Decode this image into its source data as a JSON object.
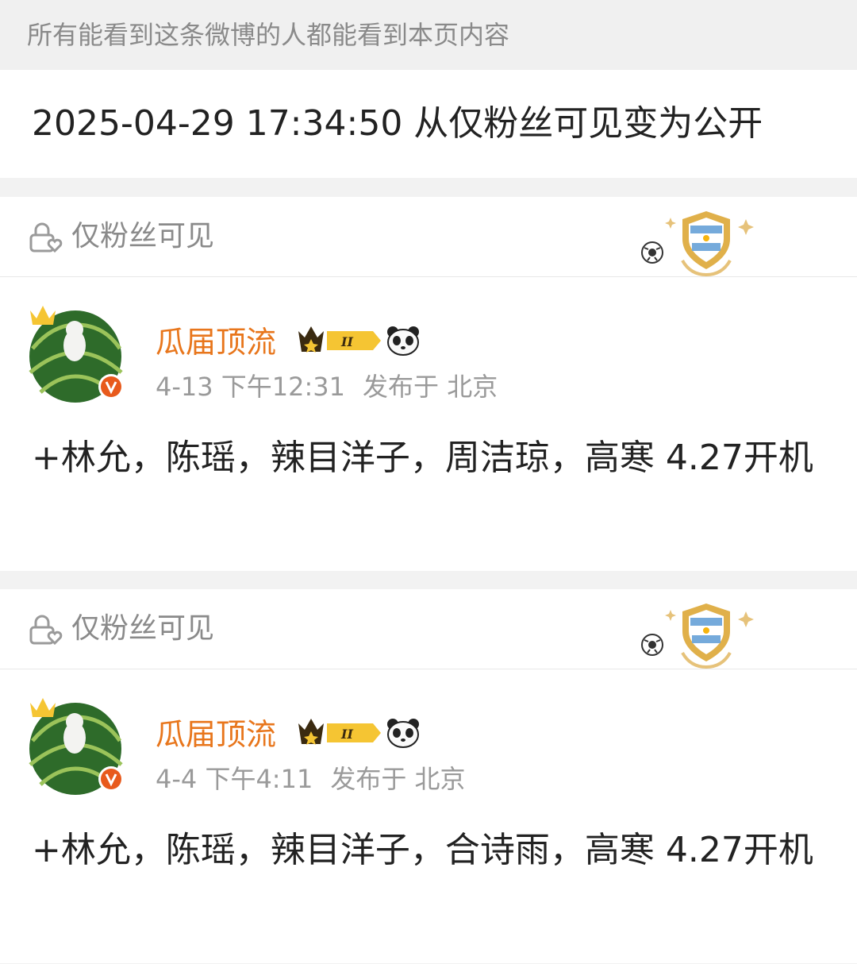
{
  "notice": "所有能看到这条微博的人都能看到本页内容",
  "change_log": "2025-04-29 17:34:50 从仅粉丝可见变为公开",
  "posts": [
    {
      "visibility": "仅粉丝可见",
      "author": "瓜届顶流",
      "vip_level": "II",
      "time": "4-13 下午12:31",
      "location": "发布于 北京",
      "content": "+林允，陈瑶，辣目洋子，周洁琼，高寒 4.27开机"
    },
    {
      "visibility": "仅粉丝可见",
      "author": "瓜届顶流",
      "vip_level": "II",
      "time": "4-4 下午4:11",
      "location": "发布于 北京",
      "content": "+林允，陈瑶，辣目洋子，合诗雨，高寒 4.27开机"
    }
  ],
  "colors": {
    "author": "#e8761c",
    "meta": "#9a9a9a",
    "badge_gold": "#e0b04a",
    "verified_red": "#e85a1c"
  }
}
